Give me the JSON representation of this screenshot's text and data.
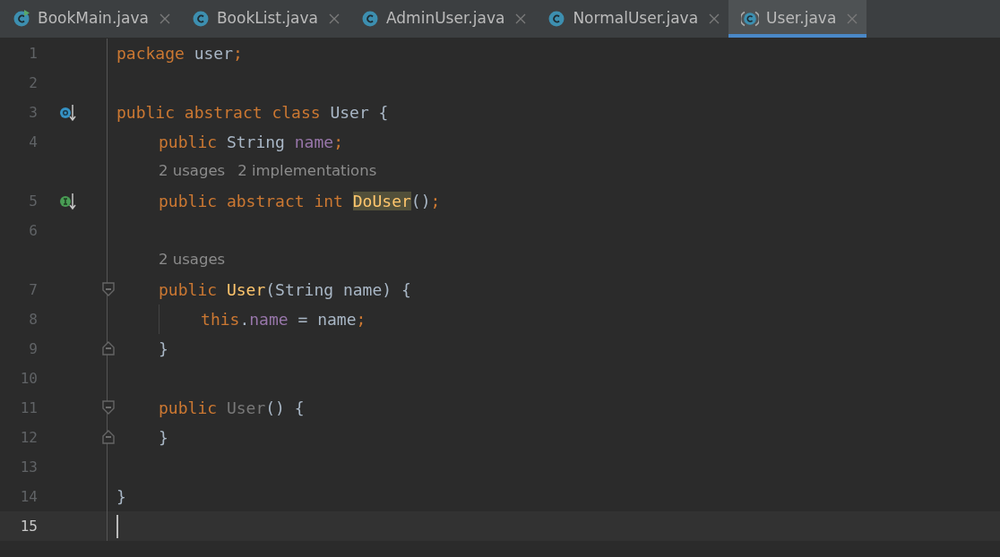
{
  "tabs": [
    {
      "label": "BookMain.java",
      "kind": "run-class",
      "selected": false
    },
    {
      "label": "BookList.java",
      "kind": "class",
      "selected": false
    },
    {
      "label": "AdminUser.java",
      "kind": "class",
      "selected": false
    },
    {
      "label": "NormalUser.java",
      "kind": "class",
      "selected": false
    },
    {
      "label": "User.java",
      "kind": "abstract-class",
      "selected": true
    }
  ],
  "editor": {
    "lines": [
      {
        "kind": "code",
        "number": "1",
        "tokens": [
          {
            "text": "package",
            "kind": "keyword"
          },
          {
            "text": " user",
            "kind": "plain"
          },
          {
            "text": ";",
            "kind": "keyword"
          }
        ]
      },
      {
        "kind": "code",
        "number": "2"
      },
      {
        "kind": "code",
        "number": "3",
        "gutter": {
          "kind": "overridden"
        },
        "tokens": [
          {
            "text": "public abstract class",
            "kind": "keyword"
          },
          {
            "text": " User {",
            "kind": "plain"
          }
        ],
        "children": [
          {
            "kind": "code",
            "number": "4",
            "tokens": [
              {
                "text": "public",
                "kind": "keyword"
              },
              {
                "text": " String ",
                "kind": "plain"
              },
              {
                "text": "name",
                "kind": "field"
              },
              {
                "text": ";",
                "kind": "keyword"
              }
            ]
          },
          {
            "kind": "hint",
            "hints": [
              "2 usages",
              "2 implementations"
            ]
          },
          {
            "kind": "code",
            "number": "5",
            "gutter": {
              "kind": "implemented"
            },
            "tokens": [
              {
                "text": "public abstract int ",
                "kind": "keyword"
              },
              {
                "text": "DoUser",
                "kind": "method",
                "highlighted": true
              },
              {
                "text": "()",
                "kind": "plain"
              },
              {
                "text": ";",
                "kind": "keyword"
              }
            ]
          },
          {
            "kind": "code",
            "number": "6"
          },
          {
            "kind": "hint",
            "hints": [
              "2 usages"
            ]
          },
          {
            "kind": "code",
            "number": "7",
            "fold": {
              "kind": "start"
            },
            "tokens": [
              {
                "text": "public ",
                "kind": "keyword"
              },
              {
                "text": "User",
                "kind": "method"
              },
              {
                "text": "(String name) {",
                "kind": "plain"
              }
            ],
            "children": [
              {
                "kind": "code",
                "number": "8",
                "tokens": [
                  {
                    "text": "this",
                    "kind": "keyword"
                  },
                  {
                    "text": ".",
                    "kind": "plain"
                  },
                  {
                    "text": "name",
                    "kind": "field"
                  },
                  {
                    "text": " = name",
                    "kind": "plain"
                  },
                  {
                    "text": ";",
                    "kind": "keyword"
                  }
                ]
              }
            ]
          },
          {
            "kind": "code",
            "number": "9",
            "fold": {
              "kind": "end"
            },
            "tokens": [
              {
                "text": "}",
                "kind": "plain"
              }
            ]
          },
          {
            "kind": "code",
            "number": "10"
          },
          {
            "kind": "code",
            "number": "11",
            "fold": {
              "kind": "start"
            },
            "tokens": [
              {
                "text": "public ",
                "kind": "keyword"
              },
              {
                "text": "User",
                "kind": "unused"
              },
              {
                "text": "() {",
                "kind": "plain"
              }
            ]
          },
          {
            "kind": "code",
            "number": "12",
            "fold": {
              "kind": "end"
            },
            "tokens": [
              {
                "text": "}",
                "kind": "plain"
              }
            ]
          },
          {
            "kind": "code",
            "number": "13"
          }
        ]
      },
      {
        "kind": "code",
        "number": "14",
        "tokens": [
          {
            "text": "}",
            "kind": "plain"
          }
        ]
      },
      {
        "kind": "code",
        "number": "15",
        "current": true
      }
    ]
  }
}
